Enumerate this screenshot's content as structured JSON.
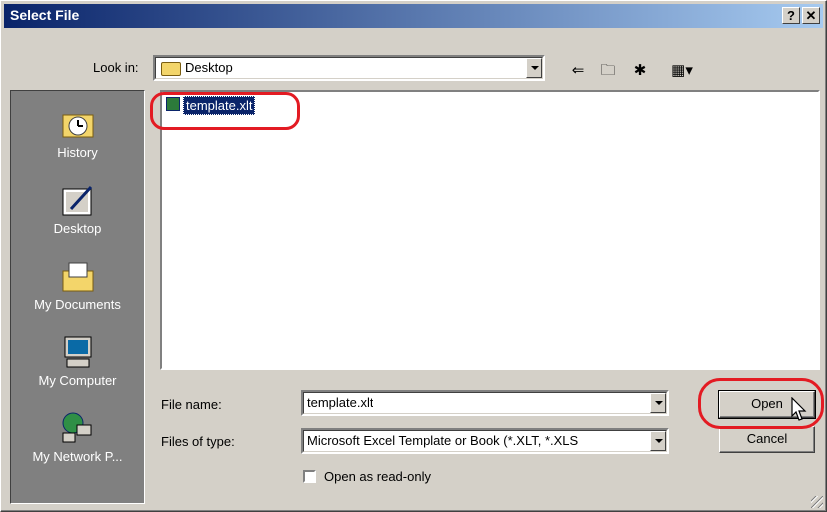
{
  "title": "Select File",
  "title_buttons": {
    "help": "?",
    "close": "✕"
  },
  "look_in": {
    "label": "Look in:",
    "value": "Desktop"
  },
  "toolbar": [
    "back-arrow-icon",
    "up-one-level-icon",
    "new-folder-icon",
    "view-menu-icon"
  ],
  "places": [
    {
      "label": "History",
      "icon": "history-icon"
    },
    {
      "label": "Desktop",
      "icon": "desktop-icon"
    },
    {
      "label": "My Documents",
      "icon": "my-documents-icon"
    },
    {
      "label": "My Computer",
      "icon": "my-computer-icon"
    },
    {
      "label": "My Network P...",
      "icon": "my-network-places-icon"
    }
  ],
  "files": [
    {
      "name": "template.xlt",
      "selected": true,
      "icon": "excel-template-icon"
    }
  ],
  "file_name": {
    "label": "File name:",
    "value": "template.xlt"
  },
  "file_type": {
    "label": "Files of type:",
    "value": "Microsoft Excel Template or Book (*.XLT, *.XLS"
  },
  "read_only": {
    "label": "Open as read-only",
    "checked": false
  },
  "buttons": {
    "open": "Open",
    "cancel": "Cancel"
  },
  "colors": {
    "highlight": "#e31b23",
    "selection": "#0a246a",
    "title_start": "#0a246a",
    "title_end": "#a6caf0",
    "places_bg": "#808080"
  }
}
